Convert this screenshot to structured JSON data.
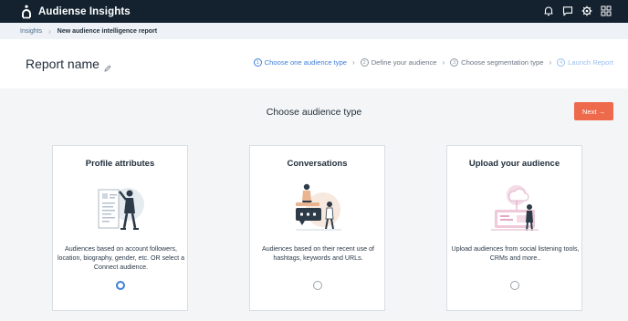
{
  "topbar": {
    "app_title": "Audiense Insights",
    "icons": [
      "bell-icon",
      "chat-icon",
      "gear-icon",
      "apps-grid-icon"
    ]
  },
  "breadcrumb": {
    "link": "Insights",
    "current": "New audience intelligence report"
  },
  "header": {
    "report_name": "Report name",
    "steps": [
      {
        "num": "1",
        "label": "Choose one audience type"
      },
      {
        "num": "2",
        "label": "Define your audience"
      },
      {
        "num": "3",
        "label": "Choose segmentation type"
      },
      {
        "num": "4",
        "label": "Launch Report"
      }
    ]
  },
  "main": {
    "title": "Choose audience type",
    "next_label": "Next →"
  },
  "cards": [
    {
      "title": "Profile attributes",
      "description": "Audiences based on account followers, location, biography, gender, etc. OR select a Connect audience.",
      "selected": true
    },
    {
      "title": "Conversations",
      "description": "Audiences based on their recent use of hashtags, keywords and URLs.",
      "selected": false
    },
    {
      "title": "Upload your audience",
      "description": "Upload audiences from social listening tools, CRMs and more..",
      "selected": false
    }
  ],
  "colors": {
    "topbar": "#14222f",
    "accent": "#3f7fd8",
    "next_button": "#ee6a4c"
  }
}
